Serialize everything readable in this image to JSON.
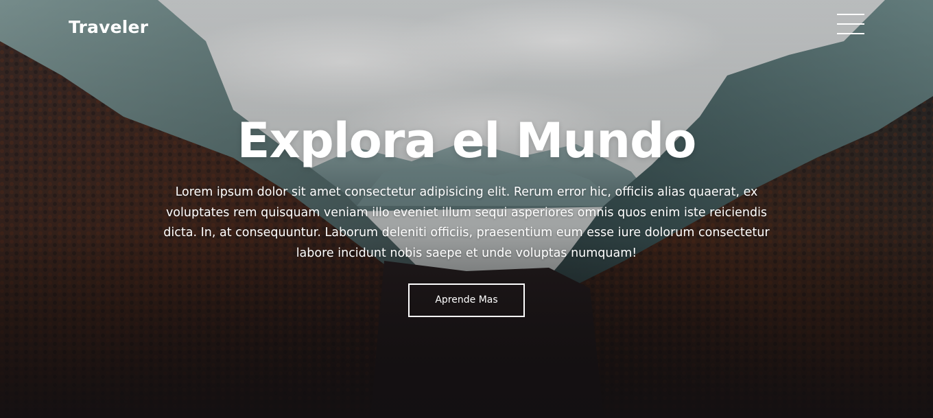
{
  "header": {
    "brand": "Traveler",
    "menu_icon": "hamburger-menu-icon"
  },
  "hero": {
    "title": "Explora el Mundo",
    "description": "Lorem ipsum dolor sit amet consectetur adipisicing elit. Rerum error hic, officiis alias quaerat, ex voluptates rem quisquam veniam illo eveniet illum sequi asperiores omnis quos enim iste reiciendis dicta. In, at consequuntur. Laborum deleniti officiis, praesentium eum esse iure dolorum consectetur labore incidunt nobis saepe et unde voluptas numquam!",
    "button_label": "Aprende Mas",
    "background_image": "mountain-valley-forest-photo"
  },
  "colors": {
    "text": "#ffffff",
    "sky": "#d2d5d6",
    "rock": "#4f6a6c",
    "forest_dark": "#1f1a1c",
    "forest_warm": "#5a2f1c"
  }
}
